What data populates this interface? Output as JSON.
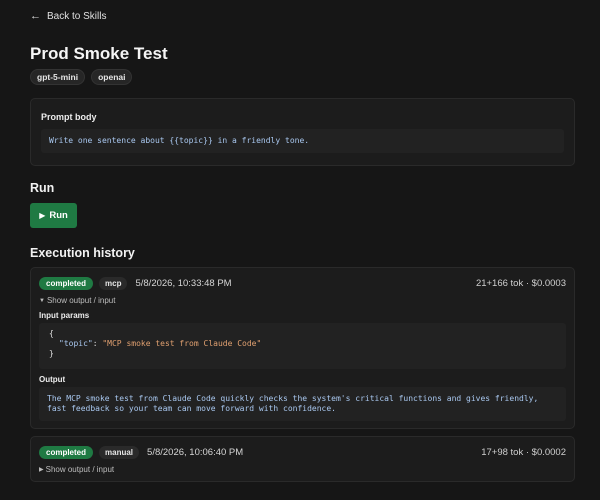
{
  "nav": {
    "back_label": "Back to Skills"
  },
  "skill": {
    "title": "Prod Smoke Test",
    "tags": [
      "gpt-5-mini",
      "openai"
    ]
  },
  "prompt": {
    "label": "Prompt body",
    "body": "Write one sentence about {{topic}} in a friendly tone."
  },
  "run": {
    "heading": "Run",
    "button_label": "Run"
  },
  "history": {
    "heading": "Execution history",
    "executions": [
      {
        "status": "completed",
        "source": "mcp",
        "timestamp": "5/8/2026, 10:33:48 PM",
        "cost": "21+166 tok · $0.0003",
        "toggle_label": "Show output / input",
        "input_label": "Input params",
        "input_open": "{",
        "input_key": "\"topic\"",
        "input_sep": ": ",
        "input_value": "\"MCP smoke test from Claude Code\"",
        "input_close": "}",
        "output_label": "Output",
        "output": "The MCP smoke test from Claude Code quickly checks the system's critical functions and gives friendly, fast feedback so your team can move forward with confidence."
      },
      {
        "status": "completed",
        "source": "manual",
        "timestamp": "5/8/2026, 10:06:40 PM",
        "cost": "17+98 tok · $0.0002",
        "toggle_label": "Show output / input"
      }
    ]
  },
  "colors": {
    "background": "#161616",
    "card": "#1c1c1c",
    "accent_green": "#1f7a43",
    "code_text": "#a9c8f0",
    "string_text": "#e0a070"
  },
  "icons": {
    "back": "arrow-left-icon",
    "run": "play-icon",
    "toggle_open": "triangle-down-icon",
    "toggle_closed": "triangle-right-icon"
  }
}
